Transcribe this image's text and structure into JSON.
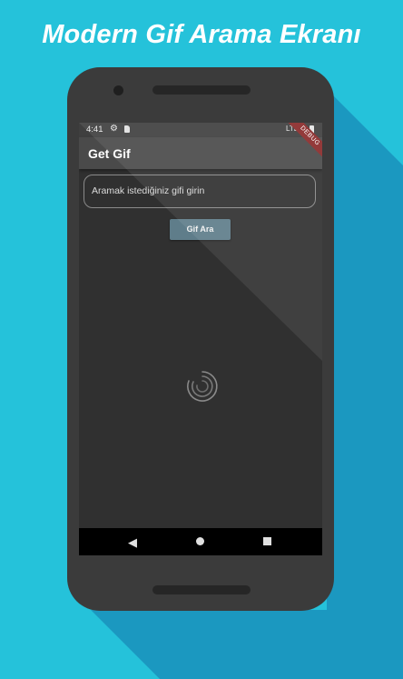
{
  "headline": "Modern Gif Arama Ekranı",
  "status_bar": {
    "time": "4:41",
    "network": "LTE",
    "icons": [
      "gear-icon",
      "sd-card-icon",
      "battery-icon"
    ]
  },
  "app_bar": {
    "title": "Get Gif",
    "debug_banner": "DEBUG"
  },
  "search": {
    "placeholder": "Aramak istediğiniz gifi girin",
    "value": ""
  },
  "search_button": {
    "label": "Gif Ara"
  },
  "nav_bar": {
    "icons": [
      "back-icon",
      "home-icon",
      "recents-icon"
    ]
  },
  "colors": {
    "background": "#25c2da",
    "phone_body": "#3b3b3b",
    "screen": "#303030",
    "app_bar": "#4a4a4a",
    "button": "#5f7d8a"
  }
}
